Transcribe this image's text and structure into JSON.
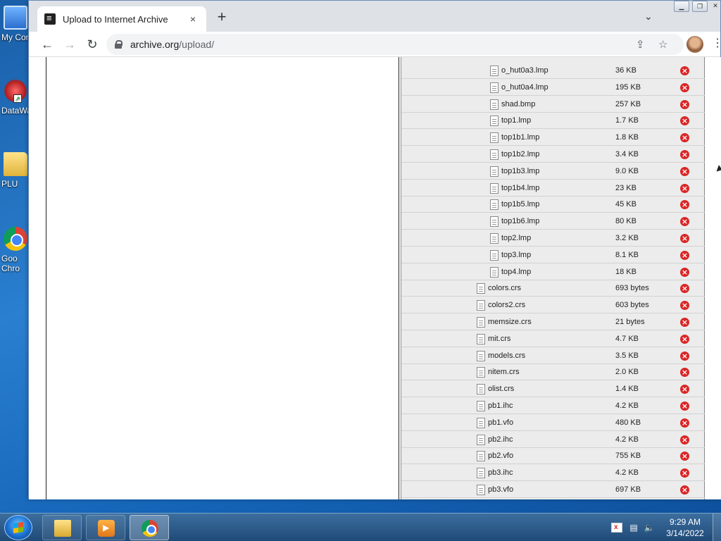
{
  "desktop": {
    "icons": [
      {
        "label": "My Con",
        "icon": "computer-icon"
      },
      {
        "label": "DataWa",
        "icon": "datawarrior-icon"
      },
      {
        "label": "PLU",
        "icon": "folder-icon"
      },
      {
        "label": "Goo Chro",
        "icon": "chrome-icon"
      }
    ]
  },
  "browser": {
    "tab_title": "Upload to Internet Archive",
    "tab_close": "×",
    "new_tab": "+",
    "tab_dropdown": "⌄",
    "url_host": "archive.org",
    "url_path": "/upload/"
  },
  "files": [
    {
      "name": "o_hut0a3.lmp",
      "size": "36 KB",
      "level": 2
    },
    {
      "name": "o_hut0a4.lmp",
      "size": "195 KB",
      "level": 2
    },
    {
      "name": "shad.bmp",
      "size": "257 KB",
      "level": 2
    },
    {
      "name": "top1.lmp",
      "size": "1.7 KB",
      "level": 2
    },
    {
      "name": "top1b1.lmp",
      "size": "1.8 KB",
      "level": 2
    },
    {
      "name": "top1b2.lmp",
      "size": "3.4 KB",
      "level": 2
    },
    {
      "name": "top1b3.lmp",
      "size": "9.0 KB",
      "level": 2
    },
    {
      "name": "top1b4.lmp",
      "size": "23 KB",
      "level": 2
    },
    {
      "name": "top1b5.lmp",
      "size": "45 KB",
      "level": 2
    },
    {
      "name": "top1b6.lmp",
      "size": "80 KB",
      "level": 2
    },
    {
      "name": "top2.lmp",
      "size": "3.2 KB",
      "level": 2
    },
    {
      "name": "top3.lmp",
      "size": "8.1 KB",
      "level": 2
    },
    {
      "name": "top4.lmp",
      "size": "18 KB",
      "level": 2
    },
    {
      "name": "colors.crs",
      "size": "693 bytes",
      "level": 1
    },
    {
      "name": "colors2.crs",
      "size": "603 bytes",
      "level": 1
    },
    {
      "name": "memsize.crs",
      "size": "21 bytes",
      "level": 1
    },
    {
      "name": "mit.crs",
      "size": "4.7 KB",
      "level": 1
    },
    {
      "name": "models.crs",
      "size": "3.5 KB",
      "level": 1
    },
    {
      "name": "nitem.crs",
      "size": "2.0 KB",
      "level": 1
    },
    {
      "name": "olist.crs",
      "size": "1.4 KB",
      "level": 1
    },
    {
      "name": "pb1.ihc",
      "size": "4.2 KB",
      "level": 1
    },
    {
      "name": "pb1.vfo",
      "size": "480 KB",
      "level": 1
    },
    {
      "name": "pb2.ihc",
      "size": "4.2 KB",
      "level": 1
    },
    {
      "name": "pb2.vfo",
      "size": "755 KB",
      "level": 1
    },
    {
      "name": "pb3.ihc",
      "size": "4.2 KB",
      "level": 1
    },
    {
      "name": "pb3.vfo",
      "size": "697 KB",
      "level": 1
    }
  ],
  "remove_glyph": "×",
  "taskbar": {
    "clock_time": "9:29 AM",
    "clock_date": "3/14/2022"
  }
}
